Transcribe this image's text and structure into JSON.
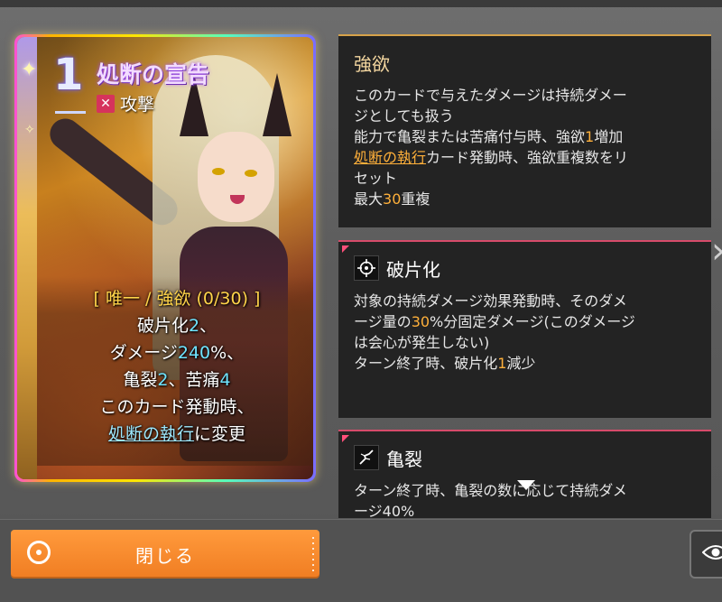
{
  "card": {
    "cost": "1",
    "title": "処断の宣告",
    "type_icon": "attack-icon",
    "type_label": "攻撃",
    "effects": {
      "line1_open": "[ 唯一 / 強欲 (0/30) ]",
      "line2_a": "破片化",
      "line2_num": "2",
      "line2_b": "、",
      "line3_a": "ダメージ",
      "line3_num": "240",
      "line3_b": "%、",
      "line4_a": "亀裂",
      "line4_num1": "2",
      "line4_b": "、苦痛",
      "line4_num2": "4",
      "line5": "このカード発動時、",
      "line6_link": "処断の執行",
      "line6_b": "に変更"
    }
  },
  "tooltips": [
    {
      "title": "強欲",
      "l1": "このカードで与えたダメージは持続ダメー",
      "l2": "ジとしても扱う",
      "l3a": "能力で亀裂または苦痛付与時、強欲",
      "l3num": "1",
      "l3b": "増加",
      "l4link": "処断の執行",
      "l4b": "カード発動時、強欲重複数をリ",
      "l5": "セット",
      "l6a": "最大",
      "l6num": "30",
      "l6b": "重複"
    },
    {
      "title": "破片化",
      "icon": "crosshair-icon",
      "l1": "対象の持続ダメージ効果発動時、そのダメ",
      "l2a": "ージ量の",
      "l2num": "30",
      "l2b": "%分固定ダメージ(このダメージ",
      "l3": "は会心が発生しない)",
      "l4a": "ターン終了時、破片化",
      "l4num": "1",
      "l4b": "減少"
    },
    {
      "title": "亀裂",
      "icon": "crack-icon",
      "l1": "ターン終了時、亀裂の数に応じて持続ダメ",
      "l2": "ージ40%"
    }
  ],
  "buttons": {
    "close_label": "閉じる"
  },
  "colors": {
    "accent_orange": "#f07d22",
    "highlight_gold": "#ffb03a",
    "number_cyan": "#6fe4ff",
    "tooltip_bg": "#232323"
  }
}
